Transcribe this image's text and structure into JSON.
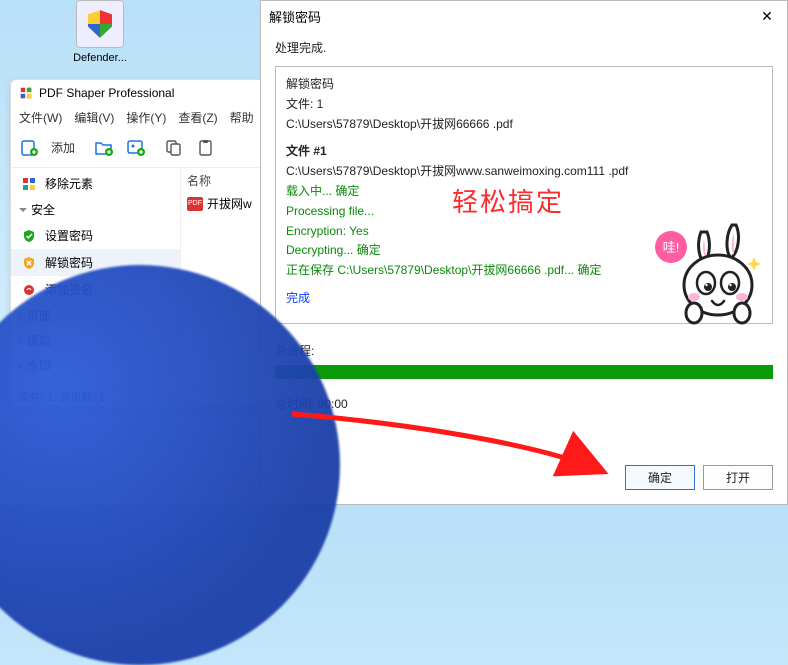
{
  "desktop": {
    "icon_label": "Defender..."
  },
  "app": {
    "title": "PDF Shaper Professional",
    "menus": {
      "file": "文件(W)",
      "edit": "编辑(V)",
      "action": "操作(Y)",
      "view": "查看(Z)",
      "help": "帮助"
    },
    "toolbar": {
      "add": "添加"
    },
    "sidebar": {
      "remove_elements": "移除元素",
      "security_header": "安全",
      "set_password": "设置密码",
      "unlock_password": "解锁密码",
      "add_signature": "添加签名",
      "page_header": "页面",
      "extract_header": "提取",
      "watermark_header": "水印"
    },
    "pane": {
      "column_name": "名称",
      "file1": "开拔网w"
    },
    "status": "文件: 1, 总页数: 1"
  },
  "dialog": {
    "title": "解锁密码",
    "close": "✕",
    "processing_done": "处理完成.",
    "log": {
      "l1": "解锁密码",
      "l2": "文件: 1",
      "l3": "C:\\Users\\57879\\Desktop\\开拔网66666 .pdf",
      "file_header": "文件 #1",
      "path": "C:\\Users\\57879\\Desktop\\开拔网www.sanweimoxing.com111 .pdf",
      "loading": "载入中... 确定",
      "processing": "Processing file...",
      "encryption": "Encryption: Yes",
      "decrypting": "Decrypting... 确定",
      "saving": "正在保存 C:\\Users\\57879\\Desktop\\开拔网66666 .pdf... 确定",
      "done": "完成"
    },
    "overlay": "轻松搞定",
    "progress_label": "总进程:",
    "time_label": "总时间: 00:00",
    "ok": "确定",
    "open": "打开",
    "bubble": "哇!"
  }
}
